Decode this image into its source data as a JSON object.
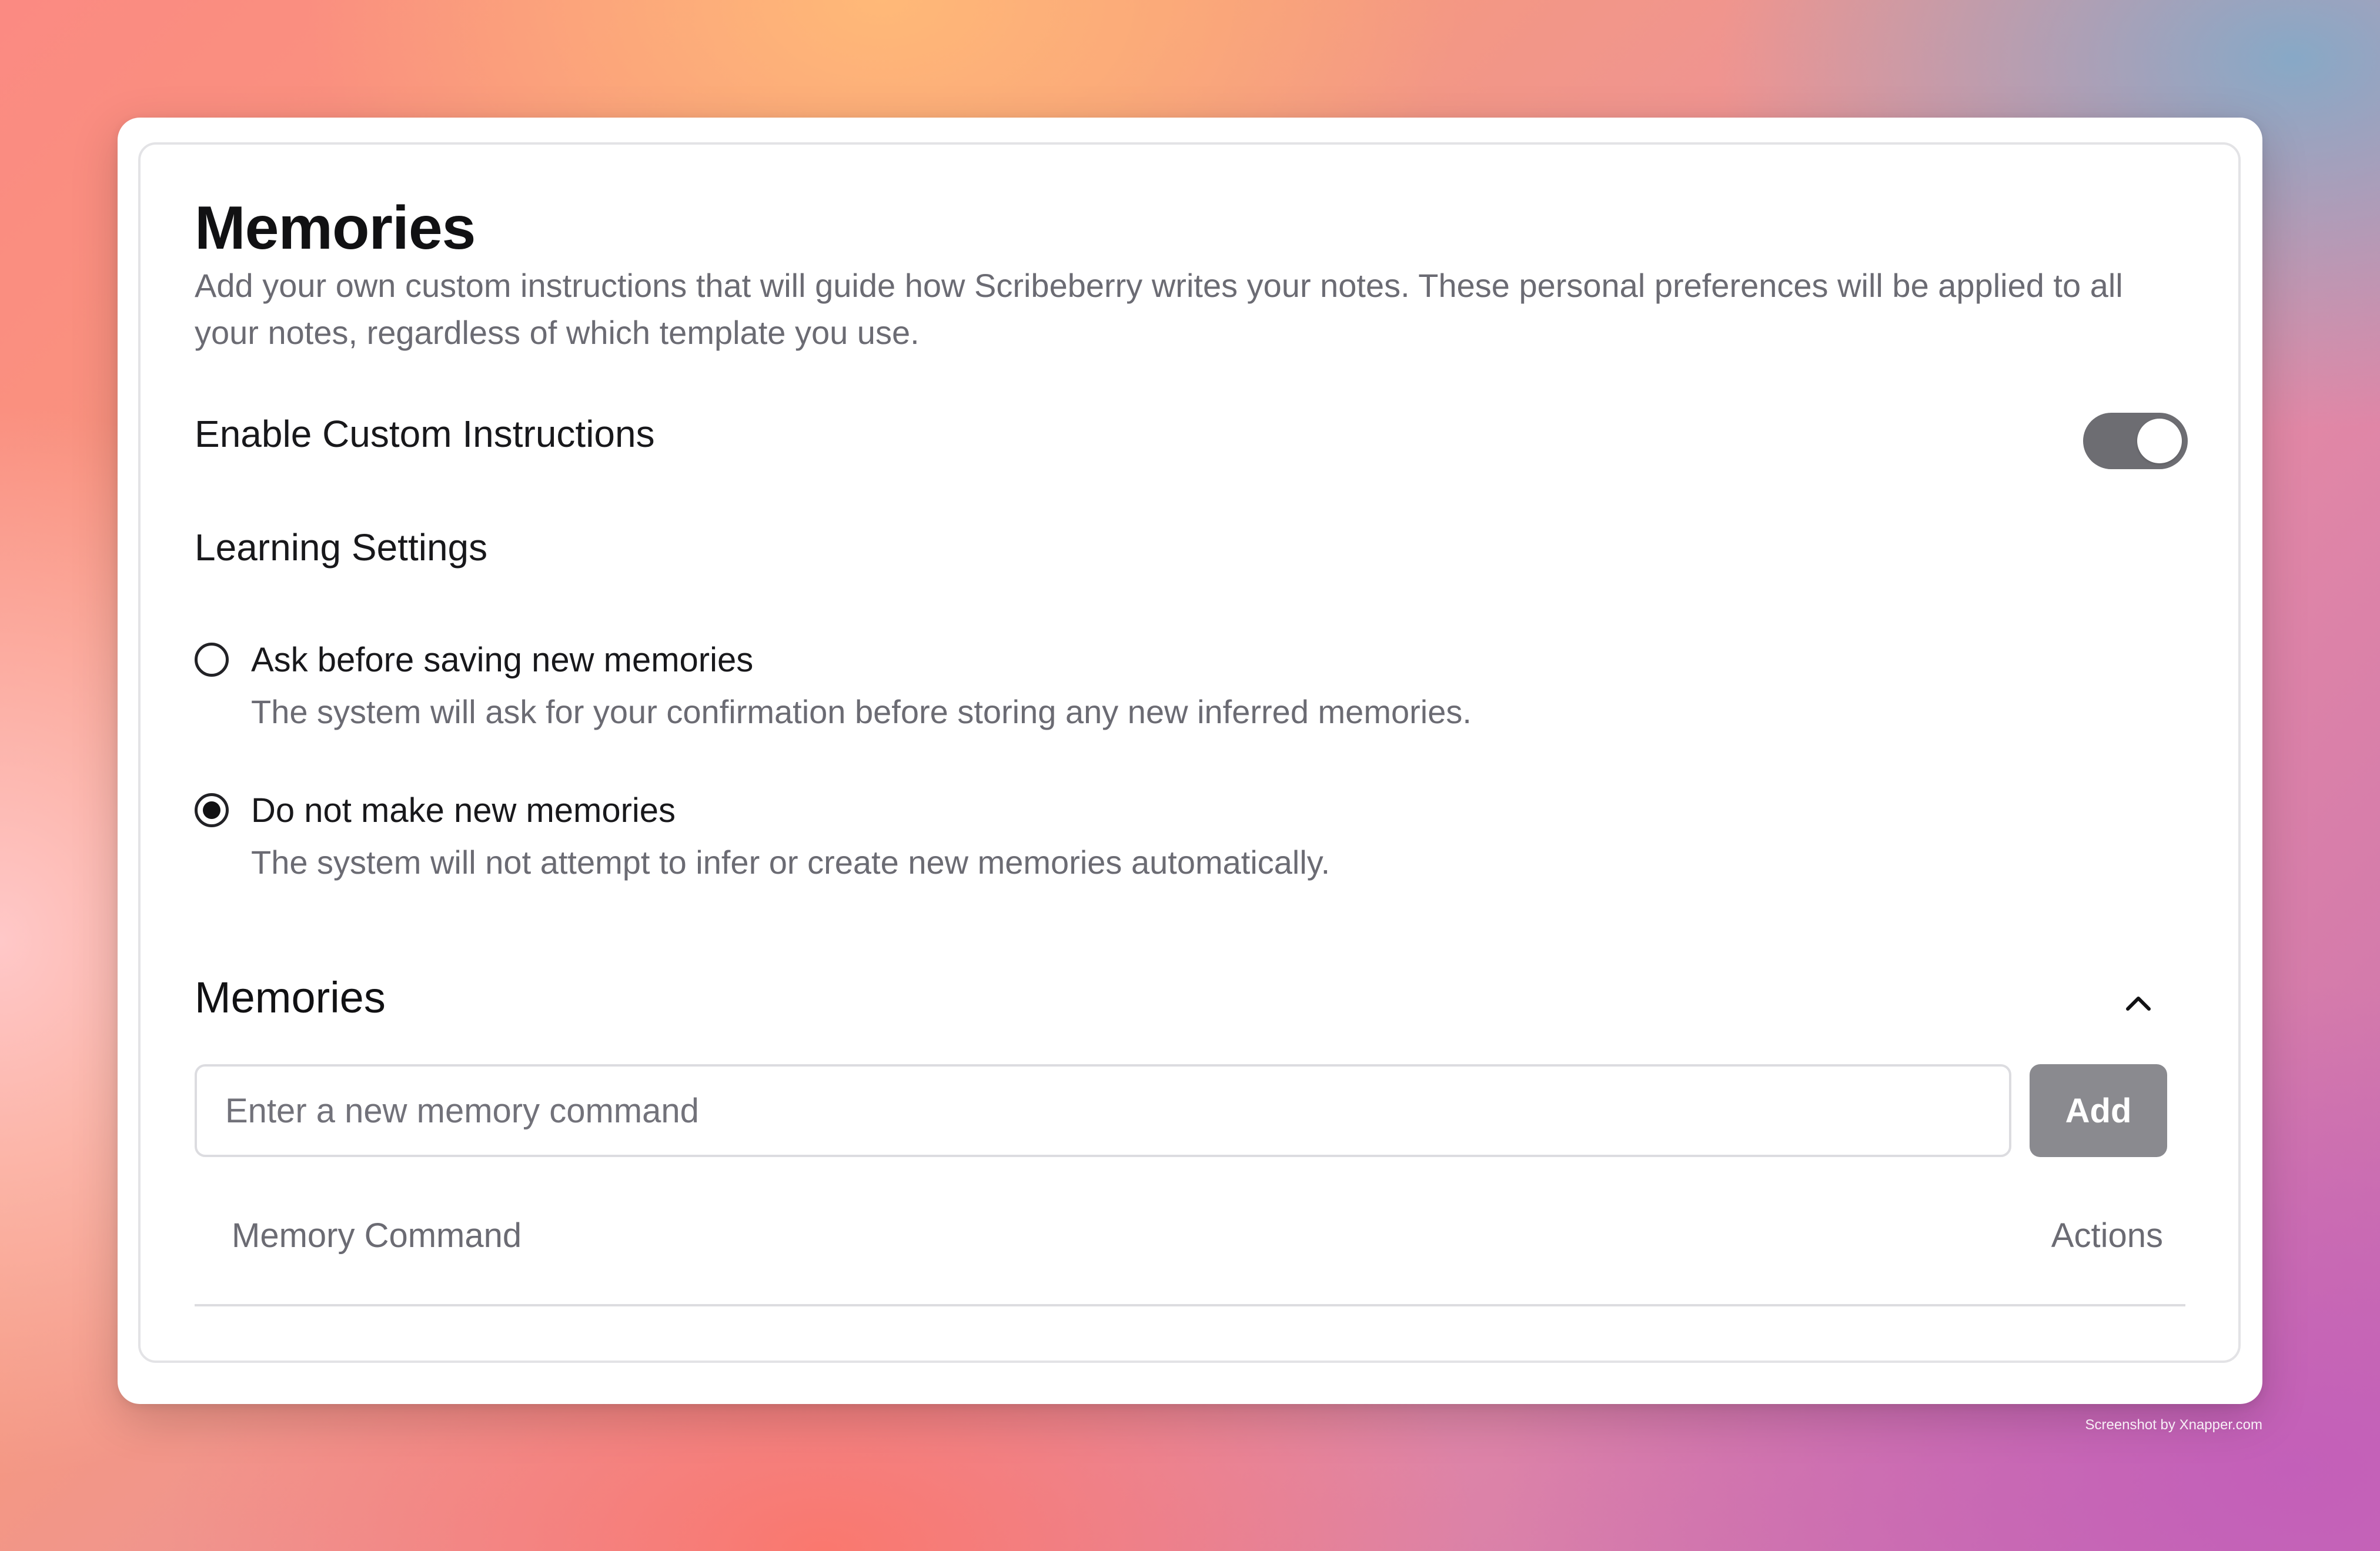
{
  "page": {
    "title": "Memories",
    "description": "Add your own custom instructions that will guide how Scribeberry writes your notes. These personal preferences will be applied to all your notes, regardless of which template you use."
  },
  "custom_instructions": {
    "label": "Enable Custom Instructions",
    "enabled": true
  },
  "learning_settings": {
    "label": "Learning Settings",
    "options": [
      {
        "title": "Ask before saving new memories",
        "description": "The system will ask for your confirmation before storing any new inferred memories.",
        "selected": false
      },
      {
        "title": "Do not make new memories",
        "description": "The system will not attempt to infer or create new memories automatically.",
        "selected": true
      }
    ]
  },
  "memories": {
    "title": "Memories",
    "input_placeholder": "Enter a new memory command",
    "input_value": "",
    "add_label": "Add",
    "collapse_icon": "chevron-up-icon",
    "columns": [
      "Memory Command",
      "Actions"
    ],
    "rows": []
  },
  "watermark": "Screenshot by Xnapper.com",
  "colors": {
    "toggle_on": "#6d6d72",
    "add_button": "#8a8a8f",
    "text_primary": "#18181b",
    "text_muted": "#6b6b73"
  }
}
